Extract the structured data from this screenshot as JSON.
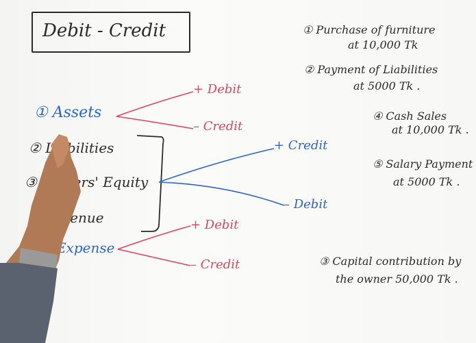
{
  "title": "Debit - Credit",
  "accounts": [
    {
      "label": "① Assets"
    },
    {
      "label": "② Liabilities"
    },
    {
      "label": "③ Owners' Equity"
    },
    {
      "label": "Revenue"
    },
    {
      "label": "Expense"
    }
  ],
  "branches": {
    "assets_plus": "+ Debit",
    "assets_minus": "– Credit",
    "group_plus": "+ Credit",
    "group_minus": "– Debit",
    "expense_plus": "+ Debit",
    "expense_minus": "– Credit"
  },
  "examples": [
    {
      "line1": "① Purchase of furniture",
      "line2": "at 10,000 Tk"
    },
    {
      "line1": "② Payment of Liabilities",
      "line2": "at 5000 Tk ."
    },
    {
      "line1": "④ Cash Sales",
      "line2": "at 10,000 Tk ."
    },
    {
      "line1": "⑤ Salary Payment",
      "line2": "at 5000 Tk ."
    },
    {
      "line1": "③ Capital contribution by",
      "line2": "the owner 50,000 Tk ."
    }
  ],
  "colors": {
    "blue_marker": "#2f63c8",
    "red_marker": "#e0435e",
    "black_marker": "#2a2a2a"
  }
}
